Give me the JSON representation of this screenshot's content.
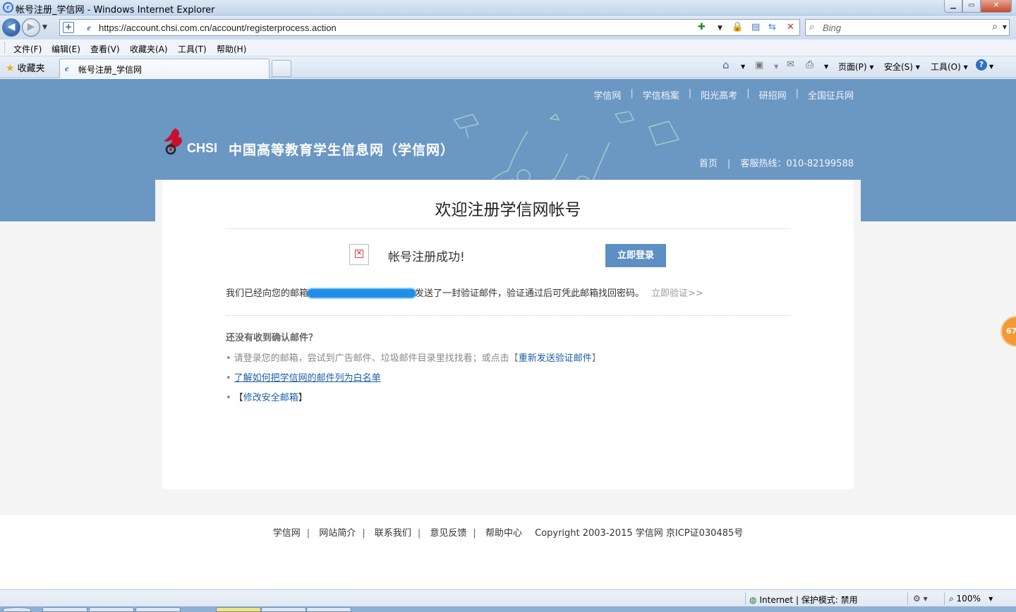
{
  "window": {
    "title": "帐号注册_学信网 - Windows Internet Explorer",
    "min_glyph": "▁",
    "max_glyph": "▭",
    "close_glyph": "✕"
  },
  "address": {
    "url": "https://account.chsi.com.cn/account/registerprocess.action",
    "search_placeholder": "Bing"
  },
  "menu": [
    "文件(F)",
    "编辑(E)",
    "查看(V)",
    "收藏夹(A)",
    "工具(T)",
    "帮助(H)"
  ],
  "tabs": {
    "favorites_label": "收藏夹",
    "active_tab": "帐号注册_学信网"
  },
  "command_bar": {
    "page": "页面(P)",
    "safety": "安全(S)",
    "tools": "工具(O)"
  },
  "site": {
    "top_nav": [
      "学信网",
      "学信档案",
      "阳光高考",
      "研招网",
      "全国征兵网"
    ],
    "logo_en": "CHSI",
    "logo_cn": "中国高等教育学生信息网（学信网）",
    "home": "首页",
    "hotline": "客服热线：010-82199588"
  },
  "content": {
    "heading": "欢迎注册学信网帐号",
    "success": "帐号注册成功!",
    "login_button": "立即登录",
    "msg_prefix": "我们已经向您的邮箱",
    "msg_suffix": "发送了一封验证邮件，验证通过后可凭此邮箱找回密码。",
    "verify_link": "立即验证>>",
    "question": "还没有收到确认邮件？",
    "tip1_text": "请登录您的邮箱，尝试到广告邮件、垃圾邮件目录里找找看；或点击【",
    "tip1_link": "重新发送验证邮件",
    "tip1_end": "】",
    "tip2_link": "了解如何把学信网的邮件列为白名单",
    "tip3_open": "【",
    "tip3_link": "修改安全邮箱",
    "tip3_close": "】"
  },
  "footer": {
    "links": [
      "学信网",
      "网站简介",
      "联系我们",
      "意见反馈",
      "帮助中心"
    ],
    "copyright": "Copyright 2003-2015 学信网 京ICP证030485号"
  },
  "float_badge": "67",
  "status": {
    "zone": "Internet | 保护模式: 禁用",
    "zoom": "100%"
  },
  "colors": {
    "banner": "#6b97c3",
    "button": "#5d8fc4",
    "link": "#1a5ea8"
  }
}
